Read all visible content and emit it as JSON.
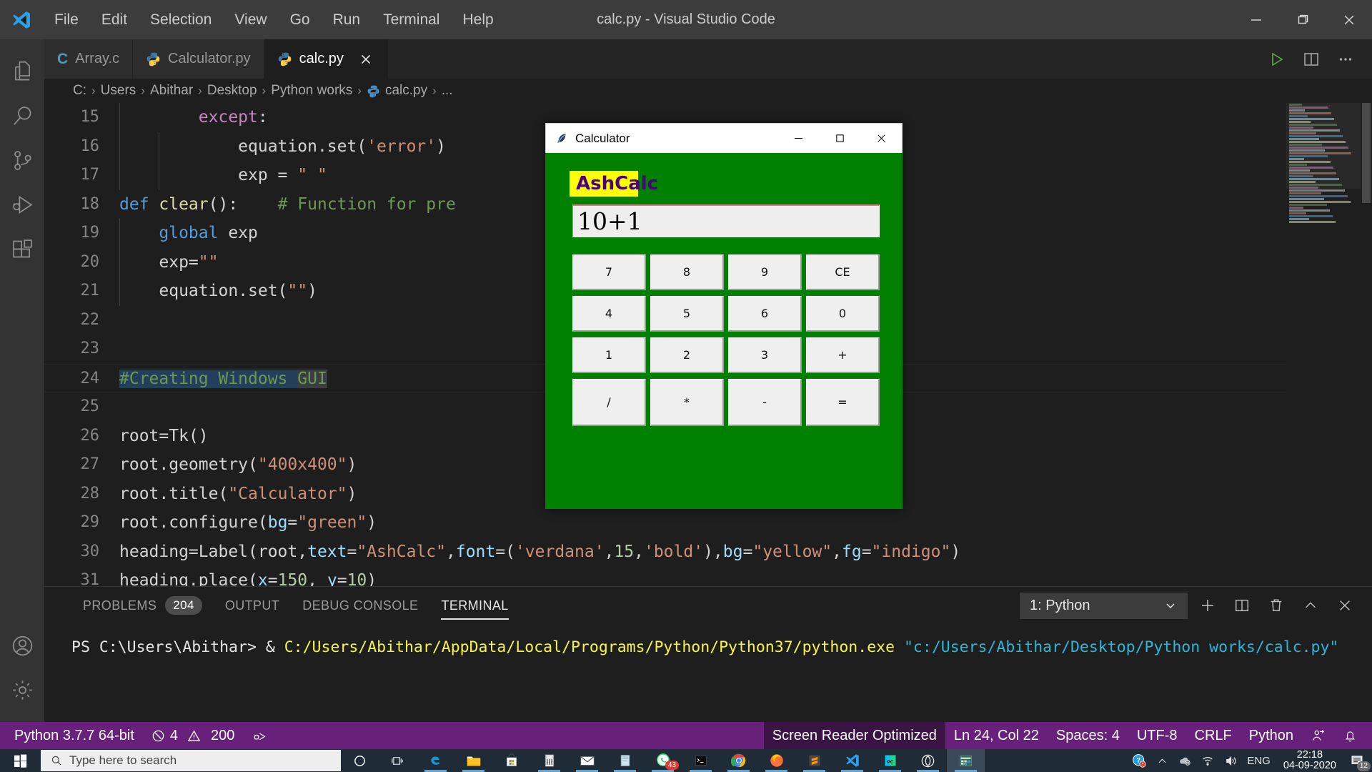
{
  "window": {
    "title": "calc.py - Visual Studio Code",
    "minimize_label": "─",
    "maximize_label": "❐",
    "close_label": "✕"
  },
  "menu": {
    "items": [
      "File",
      "Edit",
      "Selection",
      "View",
      "Go",
      "Run",
      "Terminal",
      "Help"
    ]
  },
  "activitybar": {
    "items": [
      {
        "name": "explorer-icon",
        "label": "Explorer"
      },
      {
        "name": "search-icon",
        "label": "Search"
      },
      {
        "name": "source-control-icon",
        "label": "Source Control"
      },
      {
        "name": "run-debug-icon",
        "label": "Run and Debug"
      },
      {
        "name": "extensions-icon",
        "label": "Extensions"
      },
      {
        "name": "accounts-icon",
        "label": "Accounts"
      },
      {
        "name": "manage-gear-icon",
        "label": "Manage"
      }
    ]
  },
  "tabs": [
    {
      "label": "Array.c",
      "icon": "c-file-icon",
      "active": false,
      "closable": false
    },
    {
      "label": "Calculator.py",
      "icon": "python-file-icon",
      "active": false,
      "closable": false
    },
    {
      "label": "calc.py",
      "icon": "python-file-icon",
      "active": true,
      "closable": true
    }
  ],
  "editor_actions": [
    {
      "name": "run-python-file-button",
      "label": "Run"
    },
    {
      "name": "split-editor-right-button",
      "label": "Split Editor"
    },
    {
      "name": "more-actions-button",
      "label": "More Actions..."
    }
  ],
  "breadcrumb": {
    "items": [
      "C:",
      "Users",
      "Abithar",
      "Desktop",
      "Python works",
      "calc.py",
      "..."
    ],
    "separator": "›"
  },
  "code": {
    "lines": [
      {
        "n": "15",
        "tokens": [
          {
            "t": "        ",
            "c": "plain"
          },
          {
            "t": "except",
            "c": "kwc"
          },
          {
            "t": ":",
            "c": "plain"
          }
        ]
      },
      {
        "n": "16",
        "tokens": [
          {
            "t": "            equation.set(",
            "c": "plain"
          },
          {
            "t": "'error'",
            "c": "str"
          },
          {
            "t": ")",
            "c": "plain"
          }
        ]
      },
      {
        "n": "17",
        "tokens": [
          {
            "t": "            exp = ",
            "c": "plain"
          },
          {
            "t": "\" \"",
            "c": "str"
          }
        ]
      },
      {
        "n": "18",
        "tokens": [
          {
            "t": "def ",
            "c": "kw"
          },
          {
            "t": "clear",
            "c": "fn"
          },
          {
            "t": "():    ",
            "c": "plain"
          },
          {
            "t": "# Function for pre",
            "c": "cmt"
          }
        ]
      },
      {
        "n": "19",
        "tokens": [
          {
            "t": "    ",
            "c": "plain"
          },
          {
            "t": "global",
            "c": "kw"
          },
          {
            "t": " exp",
            "c": "plain"
          }
        ]
      },
      {
        "n": "20",
        "tokens": [
          {
            "t": "    exp=",
            "c": "plain"
          },
          {
            "t": "\"\"",
            "c": "str"
          }
        ]
      },
      {
        "n": "21",
        "tokens": [
          {
            "t": "    equation.set(",
            "c": "plain"
          },
          {
            "t": "\"\"",
            "c": "str"
          },
          {
            "t": ")",
            "c": "plain"
          }
        ]
      },
      {
        "n": "22",
        "tokens": []
      },
      {
        "n": "23",
        "tokens": []
      },
      {
        "n": "24",
        "tokens": [
          {
            "t": "#Creating Windows ",
            "c": "cmt sel-hl"
          },
          {
            "t": "GUI",
            "c": "cmt word-hl"
          }
        ]
      },
      {
        "n": "25",
        "tokens": []
      },
      {
        "n": "26",
        "tokens": [
          {
            "t": "root=",
            "c": "plain"
          },
          {
            "t": "Tk",
            "c": "plain"
          },
          {
            "t": "()",
            "c": "plain"
          }
        ]
      },
      {
        "n": "27",
        "tokens": [
          {
            "t": "root.geometry(",
            "c": "plain"
          },
          {
            "t": "\"400x400\"",
            "c": "str"
          },
          {
            "t": ")",
            "c": "plain"
          }
        ]
      },
      {
        "n": "28",
        "tokens": [
          {
            "t": "root.title(",
            "c": "plain"
          },
          {
            "t": "\"Calculator\"",
            "c": "str"
          },
          {
            "t": ")",
            "c": "plain"
          }
        ]
      },
      {
        "n": "29",
        "tokens": [
          {
            "t": "root.configure(",
            "c": "plain"
          },
          {
            "t": "bg",
            "c": "param"
          },
          {
            "t": "=",
            "c": "plain"
          },
          {
            "t": "\"green\"",
            "c": "str"
          },
          {
            "t": ")",
            "c": "plain"
          }
        ]
      },
      {
        "n": "30",
        "tokens": [
          {
            "t": "heading=Label(root,",
            "c": "plain"
          },
          {
            "t": "text",
            "c": "param"
          },
          {
            "t": "=",
            "c": "plain"
          },
          {
            "t": "\"AshCalc\"",
            "c": "str"
          },
          {
            "t": ",",
            "c": "plain"
          },
          {
            "t": "font",
            "c": "param"
          },
          {
            "t": "=(",
            "c": "plain"
          },
          {
            "t": "'verdana'",
            "c": "str"
          },
          {
            "t": ",",
            "c": "plain"
          },
          {
            "t": "15",
            "c": "num"
          },
          {
            "t": ",",
            "c": "plain"
          },
          {
            "t": "'bold'",
            "c": "str"
          },
          {
            "t": "),",
            "c": "plain"
          },
          {
            "t": "bg",
            "c": "param"
          },
          {
            "t": "=",
            "c": "plain"
          },
          {
            "t": "\"yellow\"",
            "c": "str"
          },
          {
            "t": ",",
            "c": "plain"
          },
          {
            "t": "fg",
            "c": "param"
          },
          {
            "t": "=",
            "c": "plain"
          },
          {
            "t": "\"indigo\"",
            "c": "str"
          },
          {
            "t": ")",
            "c": "plain"
          }
        ]
      },
      {
        "n": "31",
        "tokens": [
          {
            "t": "heading.place(",
            "c": "plain"
          },
          {
            "t": "x",
            "c": "param"
          },
          {
            "t": "=",
            "c": "plain"
          },
          {
            "t": "150",
            "c": "num"
          },
          {
            "t": ", ",
            "c": "plain"
          },
          {
            "t": "y",
            "c": "param"
          },
          {
            "t": "=",
            "c": "plain"
          },
          {
            "t": "10",
            "c": "num"
          },
          {
            "t": ")",
            "c": "plain"
          }
        ]
      }
    ]
  },
  "calculator": {
    "title": "Calculator",
    "title_icon": "tk-feather-icon",
    "minimize_label": "─",
    "maximize_label": "☐",
    "close_label": "✕",
    "heading": "AshCalc",
    "display_value": "10+1",
    "buttons": [
      "7",
      "8",
      "9",
      "CE",
      "4",
      "5",
      "6",
      "0",
      "1",
      "2",
      "3",
      "+",
      "/",
      "*",
      "-",
      "="
    ],
    "colors": {
      "bg": "#008000",
      "heading_bg": "#ffff00",
      "heading_fg": "#4b0082",
      "display_bg": "#eeeeee",
      "button_bg": "#efefef"
    }
  },
  "panel": {
    "tabs": [
      {
        "label": "PROBLEMS",
        "badge": "204",
        "active": false
      },
      {
        "label": "OUTPUT",
        "badge": "",
        "active": false
      },
      {
        "label": "DEBUG CONSOLE",
        "badge": "",
        "active": false
      },
      {
        "label": "TERMINAL",
        "badge": "",
        "active": true
      }
    ],
    "terminal_select": "1: Python",
    "select_chevron": "⌄",
    "actions": [
      {
        "name": "new-terminal-button",
        "label": "+"
      },
      {
        "name": "split-terminal-button",
        "label": "Split"
      },
      {
        "name": "kill-terminal-button",
        "label": "Kill"
      },
      {
        "name": "maximize-panel-button",
        "label": "^"
      },
      {
        "name": "close-panel-button",
        "label": "✕"
      }
    ],
    "terminal": {
      "prompt": "PS C:\\Users\\Abithar> & ",
      "exe_path": "C:/Users/Abithar/AppData/Local/Programs/Python/Python37/python.exe ",
      "script_path": "\"c:/Users/Abithar/Desktop/Python works/calc.py\""
    }
  },
  "statusbar": {
    "left": [
      {
        "name": "python-interpreter-status",
        "label": "Python 3.7.7 64-bit"
      },
      {
        "name": "errors-warnings-status",
        "errors": "4",
        "warnings": "200"
      },
      {
        "name": "debug-status-icon",
        "label": ""
      }
    ],
    "right": [
      {
        "name": "screen-reader-status",
        "label": "Screen Reader Optimized"
      },
      {
        "name": "cursor-position-status",
        "label": "Ln 24, Col 22"
      },
      {
        "name": "indentation-status",
        "label": "Spaces: 4"
      },
      {
        "name": "encoding-status",
        "label": "UTF-8"
      },
      {
        "name": "eol-status",
        "label": "CRLF"
      },
      {
        "name": "language-mode-status",
        "label": "Python"
      },
      {
        "name": "feedback-status-icon",
        "label": ""
      },
      {
        "name": "notifications-bell-icon",
        "label": ""
      }
    ],
    "accent_color": "#68217a"
  },
  "taskbar": {
    "search_placeholder": "Type here to search",
    "icons": [
      {
        "name": "cortana-icon"
      },
      {
        "name": "task-view-icon"
      },
      {
        "name": "edge-icon"
      },
      {
        "name": "file-explorer-icon"
      },
      {
        "name": "microsoft-store-icon"
      },
      {
        "name": "calculator-app-icon"
      },
      {
        "name": "mail-icon"
      },
      {
        "name": "sticky-notes-icon"
      },
      {
        "name": "whatsapp-icon",
        "badge": "43"
      },
      {
        "name": "command-prompt-icon"
      },
      {
        "name": "chrome-icon"
      },
      {
        "name": "firefox-icon"
      },
      {
        "name": "sublime-text-icon"
      },
      {
        "name": "vscode-icon"
      },
      {
        "name": "pycharm-icon"
      },
      {
        "name": "opera-icon"
      },
      {
        "name": "python-tk-window-icon"
      }
    ],
    "tray": {
      "help_icon": "help-badge-icon",
      "chevron_icon": "show-hidden-icons-icon",
      "onedrive_icon": "onedrive-icon",
      "network_icon": "wifi-icon",
      "volume_icon": "volume-icon",
      "language": "ENG",
      "time": "22:18",
      "date": "04-09-2020",
      "notification_count": "12"
    }
  }
}
